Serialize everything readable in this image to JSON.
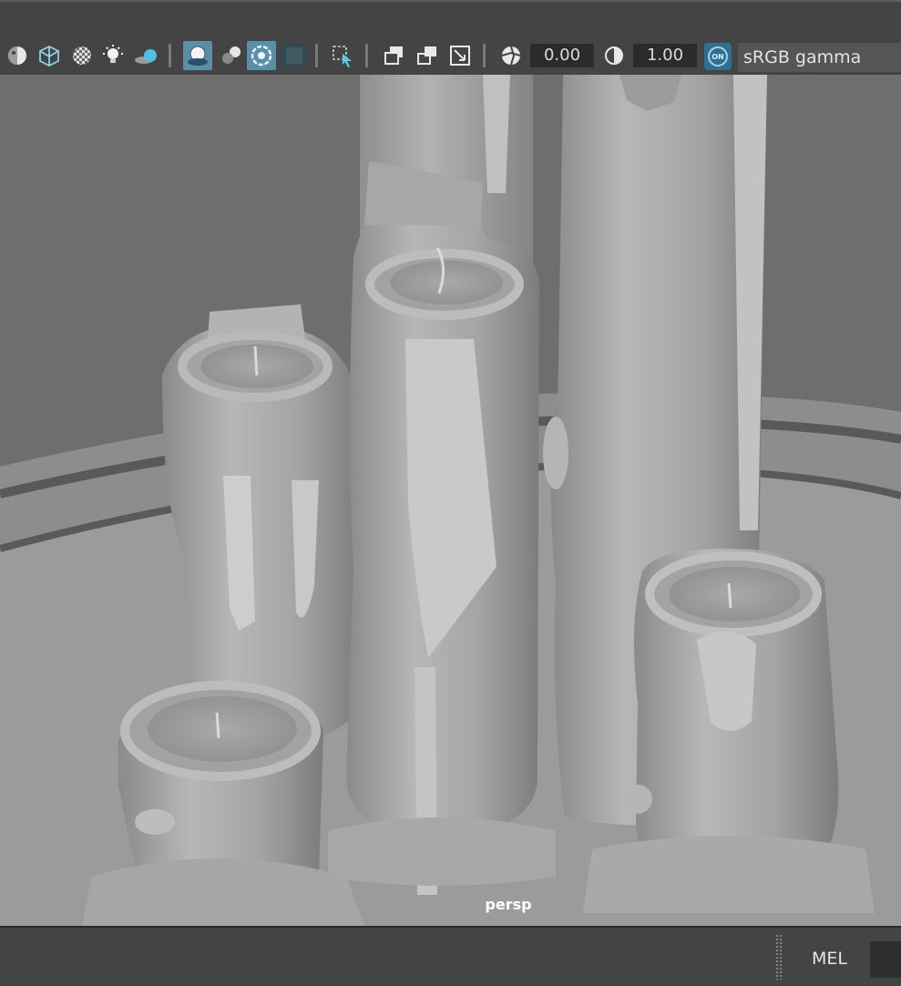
{
  "toolbar": {
    "icons": [
      "shading-sphere-icon",
      "wireframe-cube-icon",
      "checker-icon",
      "light-bulb-icon",
      "shadow-spheres-icon",
      "ambient-occlusion-icon",
      "motion-blur-icon",
      "anti-aliasing-icon",
      "depth-of-field-icon",
      "isolate-select-icon",
      "gate-mask-icon",
      "film-gate-icon",
      "resolution-gate-icon",
      "exposure-icon",
      "gamma-icon"
    ],
    "exposure_value": "0.00",
    "gamma_value": "1.00",
    "color_management_toggle": "ON",
    "color_space": "sRGB gamma"
  },
  "viewport": {
    "camera_label": "persp",
    "background": "#6e6e6e",
    "model_color": "#a6a6a6"
  },
  "command_line": {
    "language_label": "MEL"
  },
  "colors": {
    "accent": "#5b8fa8",
    "panel": "#444444"
  }
}
